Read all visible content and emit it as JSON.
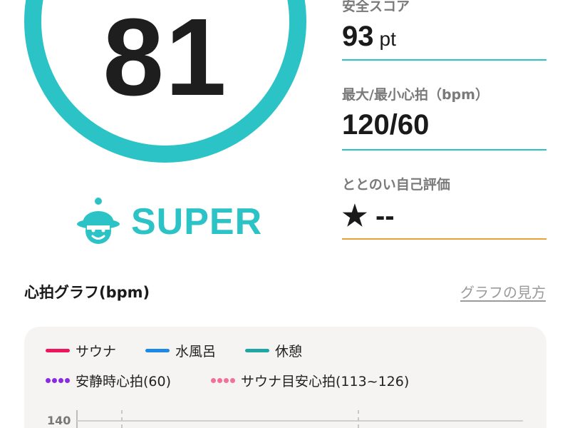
{
  "score": {
    "value": "81"
  },
  "rank": {
    "label": "SUPER",
    "icon": "sauna-hat-face-icon"
  },
  "stats": {
    "safety": {
      "label": "安全スコア",
      "value": "93",
      "unit": "pt"
    },
    "heart_rate": {
      "label": "最大/最小心拍（bpm）",
      "value": "120/60"
    },
    "self_rating": {
      "label": "ととのい自己評価",
      "value": "★ --"
    }
  },
  "graph": {
    "title": "心拍グラフ(bpm)",
    "help_link": "グラフの見方",
    "legend": {
      "sauna": {
        "label": "サウナ",
        "color": "#f0145a"
      },
      "water_bath": {
        "label": "水風呂",
        "color": "#1e88e5"
      },
      "rest": {
        "label": "休憩",
        "color": "#1fa8a3"
      },
      "resting_hr": {
        "label": "安静時心拍(60)",
        "color": "#8a2be2"
      },
      "sauna_target": {
        "label": "サウナ目安心拍(113~126)",
        "color": "#f0729a"
      }
    },
    "y_tick_top": "140"
  },
  "colors": {
    "accent": "#2cc3c6",
    "underline_orange": "#e8a13a"
  }
}
